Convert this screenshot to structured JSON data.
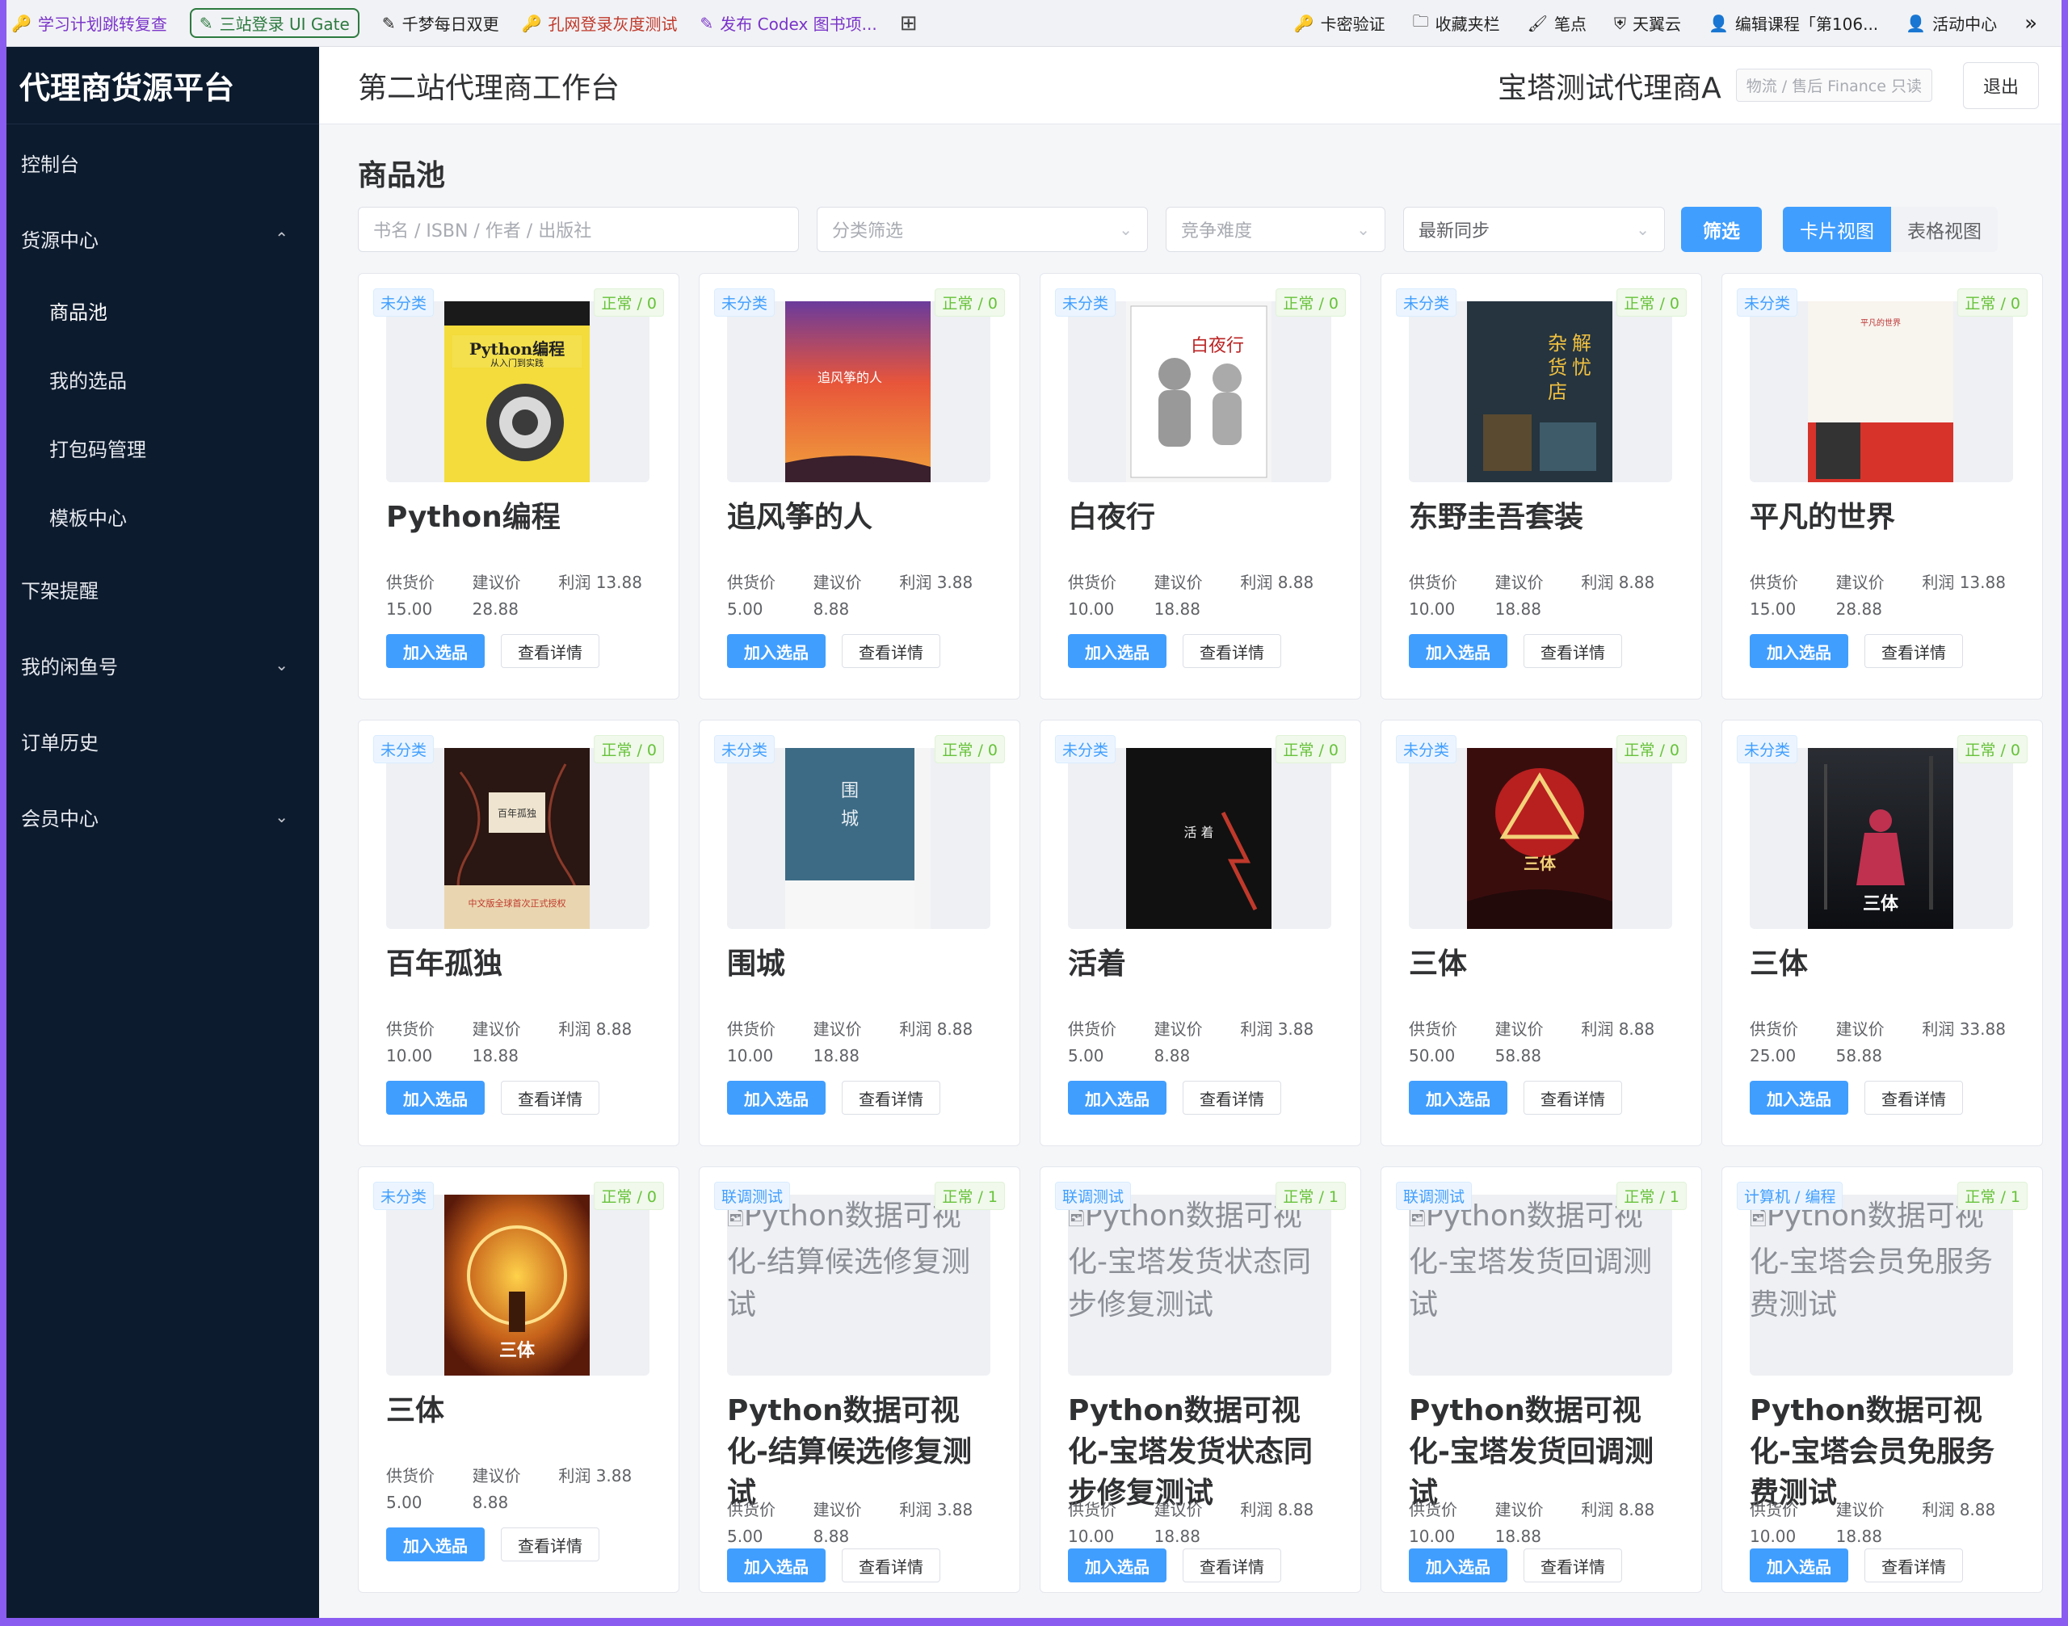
{
  "bookmarks": {
    "left": [
      {
        "label": "学习计划跳转复查",
        "style": "purple",
        "icon": "key-icon"
      },
      {
        "label": "三站登录 UI Gate",
        "style": "hl",
        "icon": "pencil-icon"
      },
      {
        "label": "千梦每日双更",
        "style": "",
        "icon": "pencil-icon"
      },
      {
        "label": "孔网登录灰度测试",
        "style": "red",
        "icon": "key-icon"
      },
      {
        "label": "发布 Codex 图书项...",
        "style": "purple",
        "icon": "pencil-icon"
      }
    ],
    "right": [
      {
        "label": "卡密验证",
        "icon": "key-icon"
      },
      {
        "label": "收藏夹栏",
        "icon": "folder-icon"
      },
      {
        "label": "笔点",
        "icon": "brush-icon"
      },
      {
        "label": "天翼云",
        "icon": "shield-icon"
      },
      {
        "label": "编辑课程「第106...",
        "icon": "user-icon"
      },
      {
        "label": "活动中心",
        "icon": "user-icon"
      }
    ],
    "more": "»"
  },
  "sidebar": {
    "brand": "代理商货源平台",
    "items": [
      {
        "label": "控制台",
        "type": "item",
        "chevron": ""
      },
      {
        "label": "货源中心",
        "type": "item",
        "chevron": "⌃"
      },
      {
        "label": "商品池",
        "type": "sub",
        "active": true
      },
      {
        "label": "我的选品",
        "type": "sub"
      },
      {
        "label": "打包码管理",
        "type": "sub"
      },
      {
        "label": "模板中心",
        "type": "sub"
      },
      {
        "label": "下架提醒",
        "type": "item",
        "chevron": ""
      },
      {
        "label": "我的闲鱼号",
        "type": "item",
        "chevron": "⌄"
      },
      {
        "label": "订单历史",
        "type": "item",
        "chevron": ""
      },
      {
        "label": "会员中心",
        "type": "item",
        "chevron": "⌄"
      }
    ]
  },
  "header": {
    "title": "第二站代理商工作台",
    "agent": "宝塔测试代理商A",
    "role": "物流 / 售后 Finance 只读",
    "logout": "退出"
  },
  "main": {
    "title": "商品池",
    "filters": {
      "search_placeholder": "书名 / ISBN / 作者 / 出版社",
      "category_placeholder": "分类筛选",
      "difficulty_placeholder": "竞争难度",
      "sort_value": "最新同步",
      "filter_button": "筛选",
      "view_card": "卡片视图",
      "view_table": "表格视图"
    },
    "labels": {
      "supply": "供货价",
      "suggest": "建议价",
      "profit": "利润",
      "add": "加入选品",
      "detail": "查看详情"
    },
    "cards": [
      {
        "cat": "未分类",
        "status": "正常 / 0",
        "name": "Python编程",
        "supply": "15.00",
        "suggest": "28.88",
        "profit": "13.88",
        "cover": "python"
      },
      {
        "cat": "未分类",
        "status": "正常 / 0",
        "name": "追风筝的人",
        "supply": "5.00",
        "suggest": "8.88",
        "profit": "3.88",
        "cover": "kite"
      },
      {
        "cat": "未分类",
        "status": "正常 / 0",
        "name": "白夜行",
        "supply": "10.00",
        "suggest": "18.88",
        "profit": "8.88",
        "cover": "byx"
      },
      {
        "cat": "未分类",
        "status": "正常 / 0",
        "name": "东野圭吾套装",
        "supply": "10.00",
        "suggest": "18.88",
        "profit": "8.88",
        "cover": "dongye"
      },
      {
        "cat": "未分类",
        "status": "正常 / 0",
        "name": "平凡的世界",
        "supply": "15.00",
        "suggest": "28.88",
        "profit": "13.88",
        "cover": "pingfan"
      },
      {
        "cat": "未分类",
        "status": "正常 / 0",
        "name": "百年孤独",
        "supply": "10.00",
        "suggest": "18.88",
        "profit": "8.88",
        "cover": "bainian"
      },
      {
        "cat": "未分类",
        "status": "正常 / 0",
        "name": "围城",
        "supply": "10.00",
        "suggest": "18.88",
        "profit": "8.88",
        "cover": "weicheng"
      },
      {
        "cat": "未分类",
        "status": "正常 / 0",
        "name": "活着",
        "supply": "5.00",
        "suggest": "8.88",
        "profit": "3.88",
        "cover": "huozhe"
      },
      {
        "cat": "未分类",
        "status": "正常 / 0",
        "name": "三体",
        "supply": "50.00",
        "suggest": "58.88",
        "profit": "8.88",
        "cover": "santi1"
      },
      {
        "cat": "未分类",
        "status": "正常 / 0",
        "name": "三体",
        "supply": "25.00",
        "suggest": "58.88",
        "profit": "33.88",
        "cover": "santi2"
      },
      {
        "cat": "未分类",
        "status": "正常 / 0",
        "name": "三体",
        "supply": "5.00",
        "suggest": "8.88",
        "profit": "3.88",
        "cover": "santi3"
      },
      {
        "cat": "联调测试",
        "status": "正常 / 1",
        "name": "Python数据可视化-结算候选修复测试",
        "supply": "5.00",
        "suggest": "8.88",
        "profit": "3.88",
        "cover": "alt",
        "alt": "Python数据可视化-结算候选修复测试"
      },
      {
        "cat": "联调测试",
        "status": "正常 / 1",
        "name": "Python数据可视化-宝塔发货状态同步修复测试",
        "supply": "10.00",
        "suggest": "18.88",
        "profit": "8.88",
        "cover": "alt",
        "alt": "Python数据可视化-宝塔发货状态同步修复测试"
      },
      {
        "cat": "联调测试",
        "status": "正常 / 1",
        "name": "Python数据可视化-宝塔发货回调测试",
        "supply": "10.00",
        "suggest": "18.88",
        "profit": "8.88",
        "cover": "alt",
        "alt": "Python数据可视化-宝塔发货回调测试"
      },
      {
        "cat": "计算机 / 编程",
        "status": "正常 / 1",
        "name": "Python数据可视化-宝塔会员免服务费测试",
        "supply": "10.00",
        "suggest": "18.88",
        "profit": "8.88",
        "cover": "alt",
        "alt": "Python数据可视化-宝塔会员免服务费测试"
      }
    ]
  }
}
